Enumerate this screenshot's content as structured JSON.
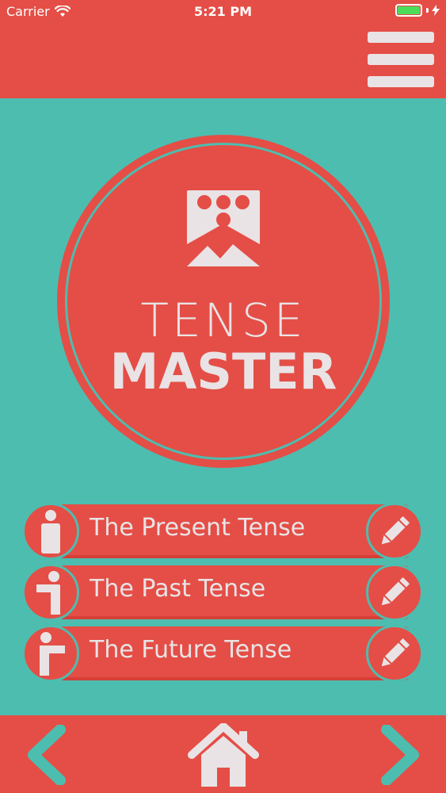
{
  "status_bar": {
    "carrier": "Carrier",
    "time": "5:21 PM",
    "icons": [
      "wifi-icon",
      "battery-icon",
      "charging-bolt-icon"
    ]
  },
  "header": {
    "menu_icon": "hamburger-menu-icon"
  },
  "logo": {
    "line1": "TENSE",
    "line2": "MASTER",
    "icon": "tense-master-logo-icon"
  },
  "tenses": [
    {
      "label": "The Present Tense",
      "figure_icon": "present-tense-figure-icon",
      "action_icon": "pencil-icon"
    },
    {
      "label": "The Past Tense",
      "figure_icon": "past-tense-figure-icon",
      "action_icon": "pencil-icon"
    },
    {
      "label": "The Future Tense",
      "figure_icon": "future-tense-figure-icon",
      "action_icon": "pencil-icon"
    }
  ],
  "bottom_nav": {
    "back_icon": "chevron-left-icon",
    "home_icon": "home-icon",
    "forward_icon": "chevron-right-icon"
  },
  "colors": {
    "primary_red": "#e44e46",
    "teal_background": "#4dbdb0",
    "light_text": "#e9e3e5",
    "battery_green": "#4ddc5a"
  }
}
